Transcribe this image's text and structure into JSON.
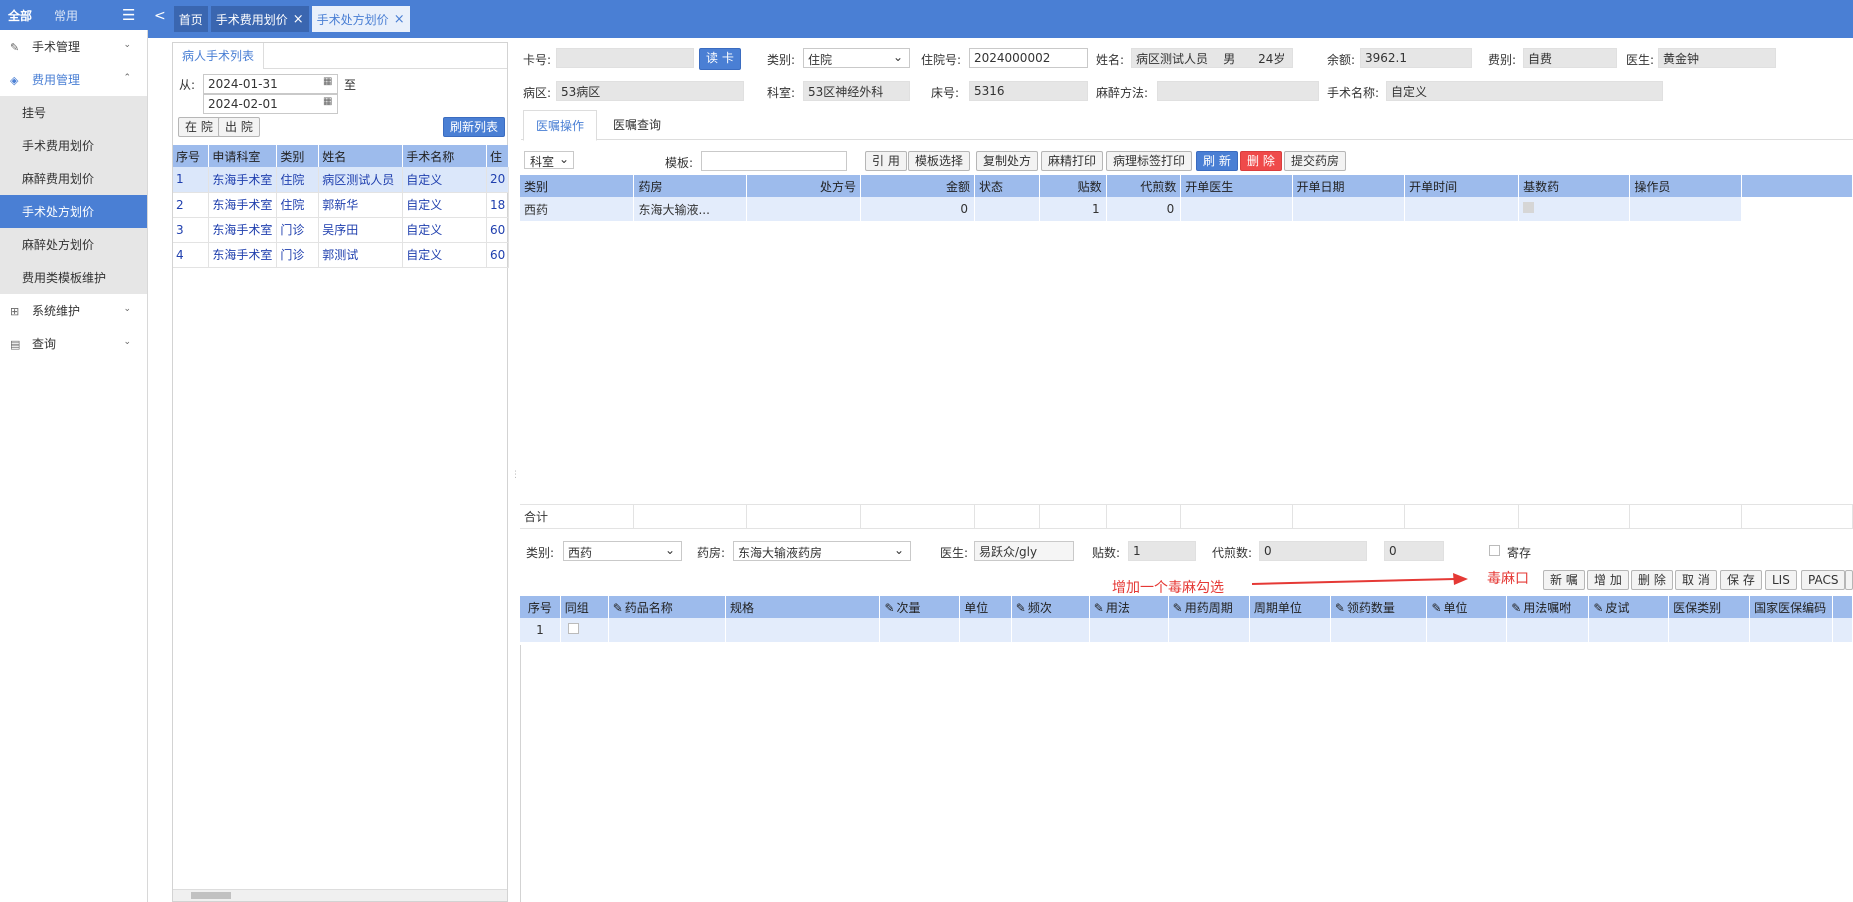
{
  "sidebar": {
    "tab_all": "全部",
    "tab_common": "常用",
    "menu": [
      {
        "label": "手术管理"
      },
      {
        "label": "费用管理"
      },
      {
        "label": "系统维护"
      },
      {
        "label": "查询"
      }
    ],
    "sub": [
      {
        "label": "挂号"
      },
      {
        "label": "手术费用划价"
      },
      {
        "label": "麻醉费用划价"
      },
      {
        "label": "手术处方划价"
      },
      {
        "label": "麻醉处方划价"
      },
      {
        "label": "费用类模板维护"
      }
    ]
  },
  "tabs": [
    {
      "label": "首页"
    },
    {
      "label": "手术费用划价"
    },
    {
      "label": "手术处方划价"
    }
  ],
  "left": {
    "title": "病人手术列表",
    "from_label": "从:",
    "to_label": "至",
    "date_from": "2024-01-31",
    "date_to": "2024-02-01",
    "btn_in": "在 院",
    "btn_out": "出 院",
    "btn_refresh": "刷新列表",
    "headers": [
      "序号",
      "申请科室",
      "类别",
      "姓名",
      "手术名称",
      "住"
    ],
    "rows": [
      [
        "1",
        "东海手术室",
        "住院",
        "病区测试人员",
        "自定义",
        "20"
      ],
      [
        "2",
        "东海手术室",
        "住院",
        "郭新华",
        "自定义",
        "18"
      ],
      [
        "3",
        "东海手术室",
        "门诊",
        "吴序田",
        "自定义",
        "60"
      ],
      [
        "4",
        "东海手术室",
        "门诊",
        "郭测试",
        "自定义",
        "60"
      ]
    ]
  },
  "info": {
    "card_label": "卡号:",
    "read_card": "读 卡",
    "type_label": "类别:",
    "type_value": "住院",
    "inpat_label": "住院号:",
    "inpat_value": "2024000002",
    "name_label": "姓名:",
    "name_value": "病区测试人员    男      24岁",
    "balance_label": "余额:",
    "balance_value": "3962.1",
    "fee_label": "费别:",
    "fee_value": "自费",
    "doctor_label": "医生:",
    "doctor_value": "黄金钟",
    "ward_label": "病区:",
    "ward_value": "53病区",
    "dept_label": "科室:",
    "dept_value": "53区神经外科",
    "bed_label": "床号:",
    "bed_value": "5316",
    "anes_label": "麻醉方法:",
    "anes_value": "",
    "surg_label": "手术名称:",
    "surg_value": "自定义"
  },
  "subtabs": [
    "医嘱操作",
    "医嘱查询"
  ],
  "toolbar": {
    "dept": "科室",
    "template_label": "模板:",
    "btns": [
      "引 用",
      "模板选择",
      "复制处方",
      "麻精打印",
      "病理标签打印",
      "刷 新",
      "删 除",
      "提交药房"
    ]
  },
  "upper": {
    "headers": [
      "类别",
      "药房",
      "处方号",
      "金额",
      "状态",
      "贴数",
      "代煎数",
      "开单医生",
      "开单日期",
      "开单时间",
      "基数药",
      "操作员"
    ],
    "row": [
      "西药",
      "东海大输液...",
      "",
      "0",
      "",
      "1",
      "0",
      "",
      "",
      "",
      "",
      ""
    ],
    "total_label": "合计"
  },
  "form": {
    "type_label": "类别:",
    "type_value": "西药",
    "pharm_label": "药房:",
    "pharm_value": "东海大输液药房",
    "doc_label": "医生:",
    "doc_value": "易跃众/gly",
    "tie_label": "贴数:",
    "tie_value": "1",
    "dj_label": "代煎数:",
    "dj_value": "0",
    "dj_value2": "0",
    "ji_label": "寄存"
  },
  "annot": {
    "text1": "增加一个毒麻勾选",
    "text2": "毒麻口"
  },
  "lower_btns": [
    "新 嘱",
    "增 加",
    "删 除",
    "取 消",
    "保 存",
    "LIS",
    "PACS"
  ],
  "lower": {
    "headers": [
      "序号",
      "同组",
      "药品名称",
      "规格",
      "次量",
      "单位",
      "频次",
      "用法",
      "用药周期",
      "周期单位",
      "领药数量",
      "单位",
      "用法嘱咐",
      "皮试",
      "医保类别",
      "国家医保编码"
    ],
    "row1": "1"
  }
}
